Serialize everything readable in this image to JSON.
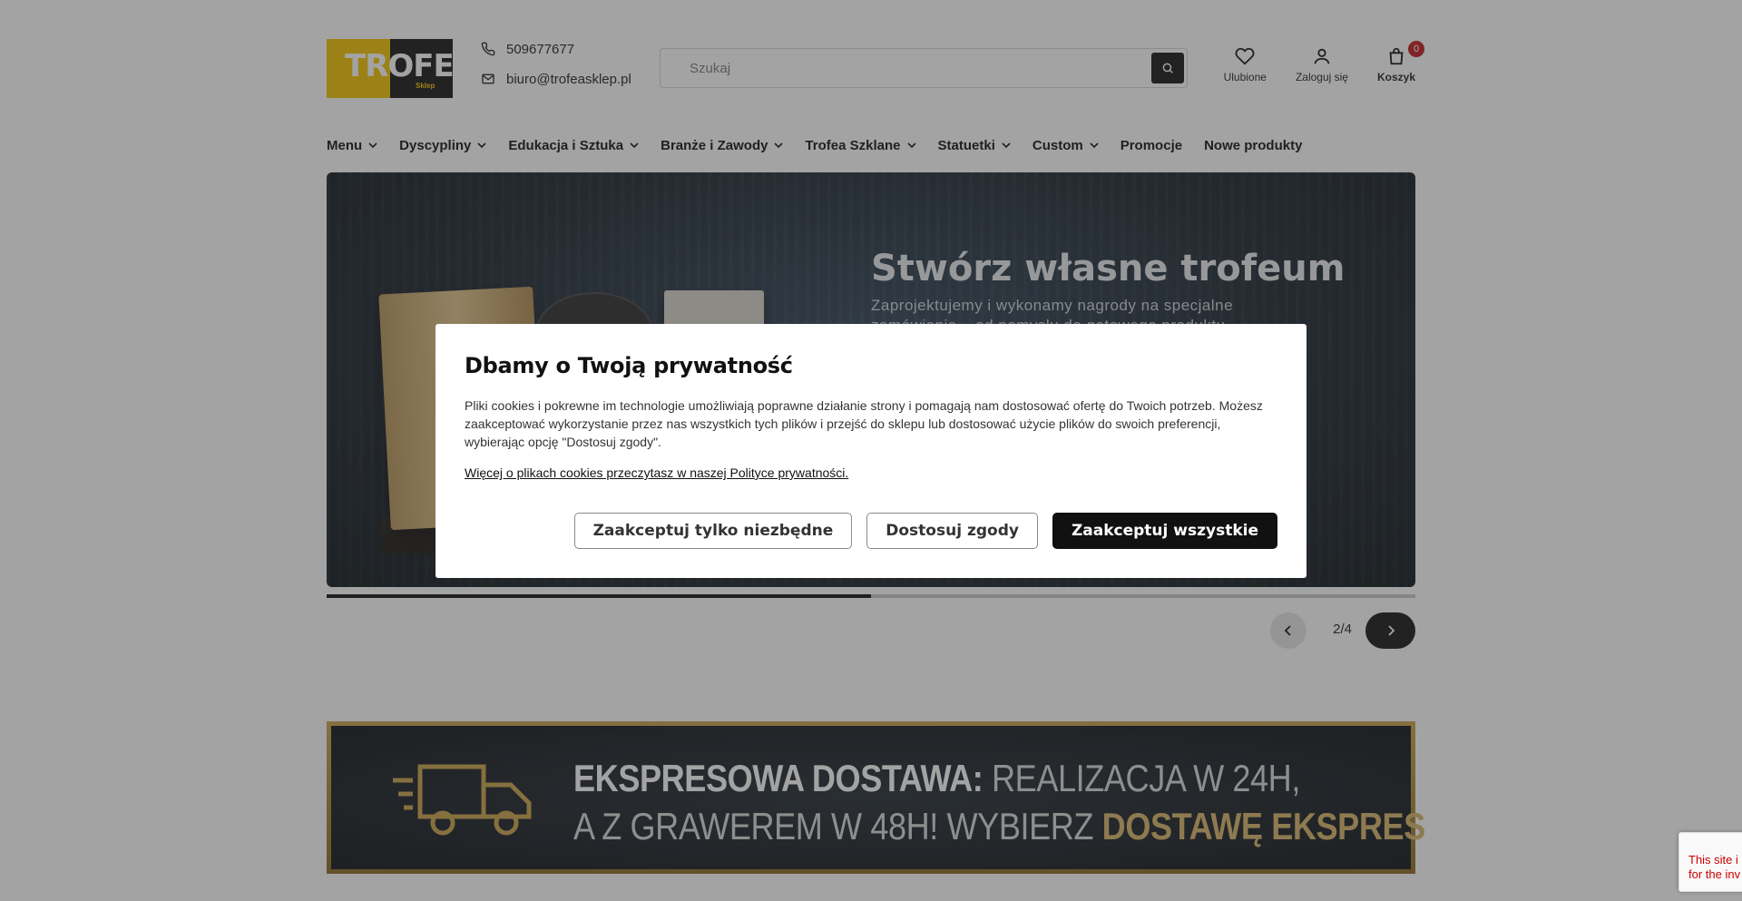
{
  "header": {
    "logo_text": "TROFEA",
    "logo_sub": "Sklep",
    "phone": "509677677",
    "email": "biuro@trofeasklep.pl",
    "search_placeholder": "Szukaj",
    "favorites_label": "Ulubione",
    "login_label": "Zaloguj się",
    "cart_label": "Koszyk",
    "cart_count": "0"
  },
  "nav": {
    "items": [
      {
        "label": "Menu",
        "dropdown": true
      },
      {
        "label": "Dyscypliny",
        "dropdown": true
      },
      {
        "label": "Edukacja i Sztuka",
        "dropdown": true
      },
      {
        "label": "Branże i Zawody",
        "dropdown": true
      },
      {
        "label": "Trofea Szklane",
        "dropdown": true
      },
      {
        "label": "Statuetki",
        "dropdown": true
      },
      {
        "label": "Custom",
        "dropdown": true
      },
      {
        "label": "Promocje",
        "dropdown": false
      },
      {
        "label": "Nowe produkty",
        "dropdown": false
      }
    ]
  },
  "hero": {
    "title": "Stwórz własne trofeum",
    "subtitle": "Zaprojektujemy i wykonamy nagrody na specjalne zamówienie – od pomysłu do gotowego produktu",
    "slide_counter": "2/4",
    "progress": 0.5
  },
  "banner": {
    "line1_bold": "EKSPRESOWA DOSTAWA:",
    "line1_rest": " REALIZACJA W 24H,",
    "line2_rest": "A Z GRAWEREM W 48H! WYBIERZ ",
    "line2_bold": "DOSTAWĘ EKSPRES"
  },
  "cookie": {
    "title": "Dbamy o Twoją prywatność",
    "body": "Pliki cookies i pokrewne im technologie umożliwiają poprawne działanie strony i pomagają nam dostosować ofertę do Twoich potrzeb. Możesz zaakceptować wykorzystanie przez nas wszystkich tych plików i przejść do sklepu lub dostosować użycie plików do swoich preferencji, wybierając opcję \"Dostosuj zgody\".",
    "policy_link": "Więcej o plikach cookies przeczytasz w naszej Polityce prywatności.",
    "btn_necessary": "Zaakceptuj tylko niezbędne",
    "btn_customize": "Dostosuj zgody",
    "btn_accept_all": "Zaakceptuj wszystkie"
  },
  "recaptcha": {
    "line1": "This site i",
    "line2": "for the inv"
  },
  "colors": {
    "accent_gold": "#d8b469",
    "badge_red": "#c0181e",
    "dark": "#141414"
  }
}
